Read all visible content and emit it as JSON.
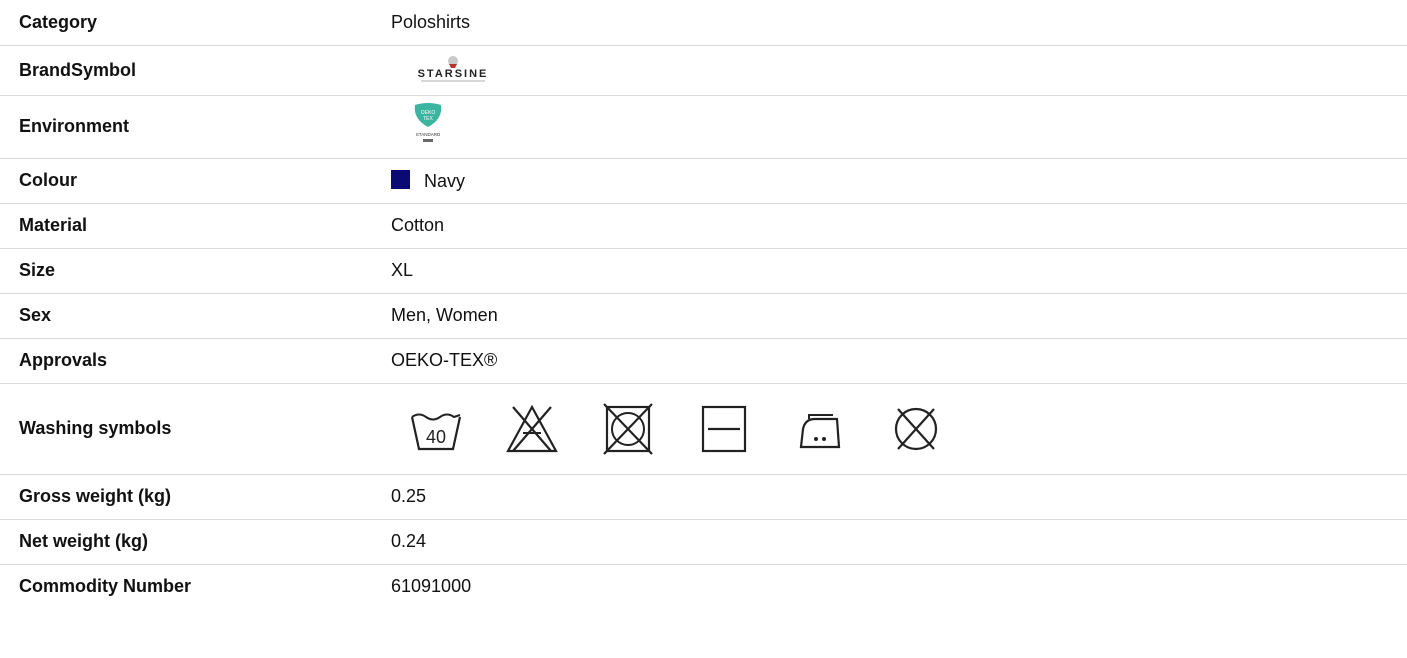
{
  "rows": [
    {
      "label": "Category",
      "value": "Poloshirts"
    },
    {
      "label": "BrandSymbol",
      "logo_text": "STARSINE",
      "logo_icon": "brand-logo-icon"
    },
    {
      "label": "Environment",
      "badge_text": "OEKO TEX",
      "badge_caption": "STANDARD",
      "badge_icon": "oeko-tex-leaf-icon",
      "badge_color": "#3ab5a0"
    },
    {
      "label": "Colour",
      "value": "Navy",
      "swatch_color": "#0b0a72"
    },
    {
      "label": "Material",
      "value": "Cotton"
    },
    {
      "label": "Size",
      "value": "XL"
    },
    {
      "label": "Sex",
      "value": "Men, Women"
    },
    {
      "label": "Approvals",
      "value": "OEKO-TEX®"
    },
    {
      "label": "Washing symbols",
      "icons": [
        "wash-40-icon",
        "no-bleach-icon",
        "no-tumble-dry-icon",
        "flat-dry-icon",
        "iron-medium-icon",
        "no-dry-clean-icon"
      ],
      "wash_temp": "40"
    },
    {
      "label": "Gross weight (kg)",
      "value": "0.25"
    },
    {
      "label": "Net weight (kg)",
      "value": "0.24"
    },
    {
      "label": "Commodity Number",
      "value": "61091000"
    }
  ]
}
